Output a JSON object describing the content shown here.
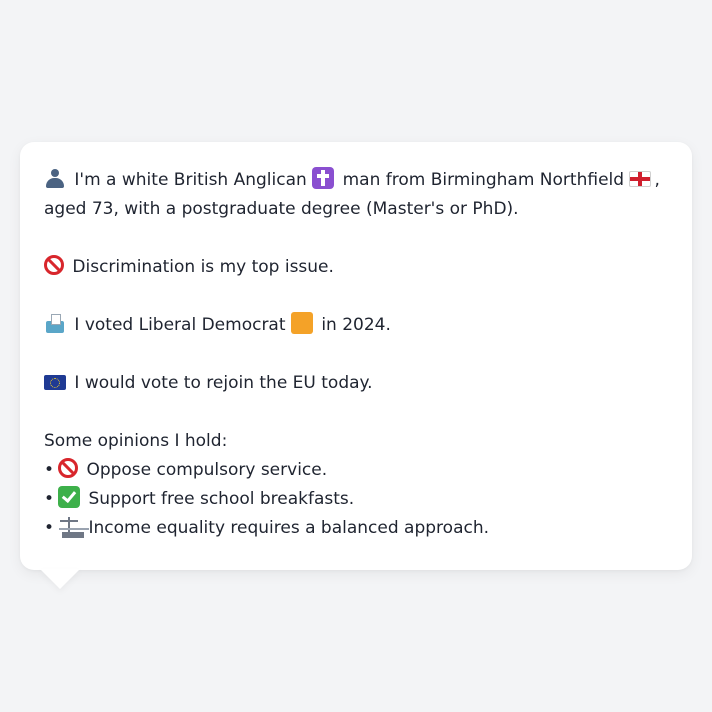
{
  "profile": {
    "intro_part1": "I'm a white British Anglican",
    "intro_part2": "man from Birmingham Northfield",
    "intro_part3": ", aged 73, with a postgraduate degree (Master's or PhD).",
    "top_issue_text": "Discrimination is my top issue.",
    "vote_part1": "I voted Liberal Democrat",
    "vote_part2": "in 2024.",
    "eu_text": "I would vote to rejoin the EU today.",
    "opinions_heading": "Some opinions I hold:",
    "bullet_char": "•",
    "opinions": [
      {
        "text": "Oppose compulsory service.",
        "icon": "prohibited-icon"
      },
      {
        "text": "Support free school breakfasts.",
        "icon": "check-mark-icon"
      },
      {
        "text": "Income equality requires a balanced approach.",
        "icon": "scales-icon"
      }
    ]
  },
  "icons": {
    "person": "person-silhouette-icon",
    "cross": "latin-cross-icon",
    "flag": "england-flag-icon",
    "prohibited": "prohibited-icon",
    "ballot": "ballot-box-icon",
    "party_color": "orange-square-icon",
    "eu": "eu-flag-icon"
  },
  "colors": {
    "background": "#f3f4f6",
    "card": "#ffffff",
    "text": "#1f2430",
    "party_orange": "#f4a228",
    "prohibited_red": "#d8262c",
    "check_green": "#3db04a"
  }
}
